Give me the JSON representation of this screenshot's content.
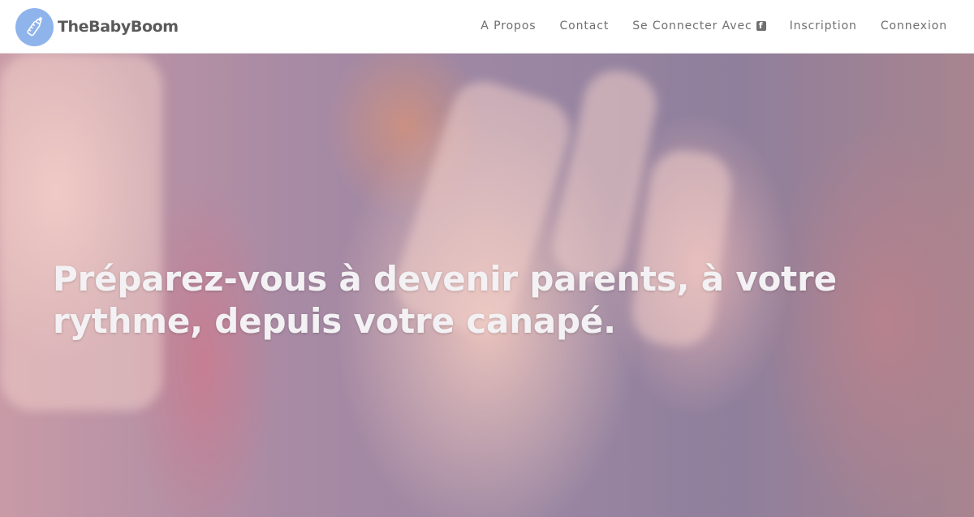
{
  "brand": {
    "name": "TheBabyBoom",
    "logo_icon": "baby-bottle-icon",
    "logo_color": "#8fb4ec"
  },
  "nav": {
    "about": "A Propos",
    "contact": "Contact",
    "facebook_login": "Se Connecter Avec",
    "facebook_icon": "facebook-icon",
    "signup": "Inscription",
    "login": "Connexion"
  },
  "hero": {
    "title_line1": "Préparez-vous à devenir parents, à votre",
    "title_line2": "rythme, depuis votre canapé."
  }
}
